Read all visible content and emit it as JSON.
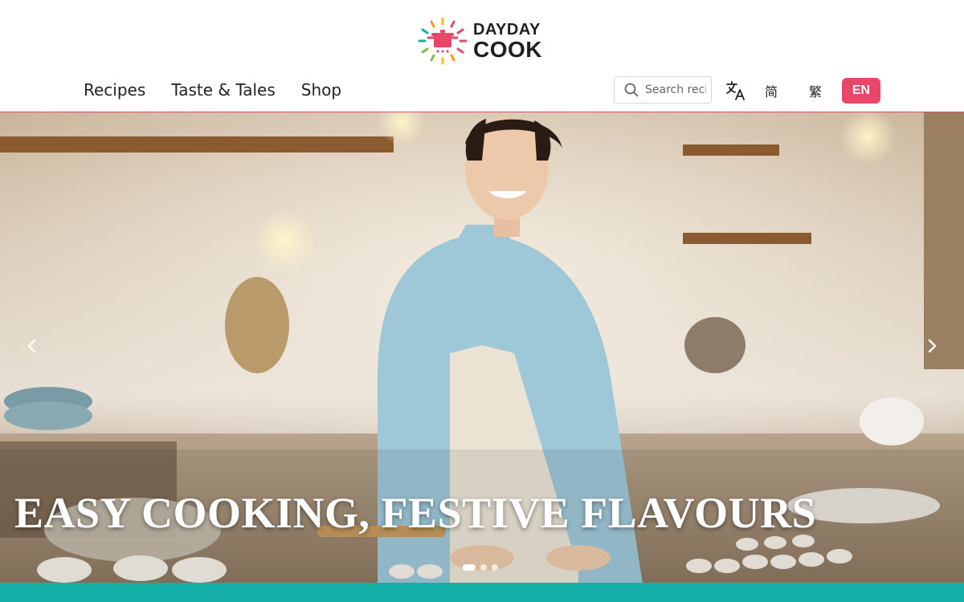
{
  "brand": {
    "line1": "DAYDAY",
    "line2": "COOK"
  },
  "nav": {
    "items": [
      {
        "label": "Recipes"
      },
      {
        "label": "Taste & Tales"
      },
      {
        "label": "Shop"
      }
    ]
  },
  "search": {
    "placeholder": "Search recipes"
  },
  "language": {
    "simplified": "简",
    "traditional": "繁",
    "english": "EN",
    "active": "EN"
  },
  "hero": {
    "caption": "EASY COOKING, FESTIVE FLAVOURS",
    "slides_total": 3,
    "active_slide": 1
  },
  "colors": {
    "accent": "#e8476a",
    "teal": "#14b0a8",
    "text": "#222222"
  },
  "icons": [
    "search-icon",
    "translate-icon",
    "chevron-left-icon",
    "chevron-right-icon"
  ]
}
